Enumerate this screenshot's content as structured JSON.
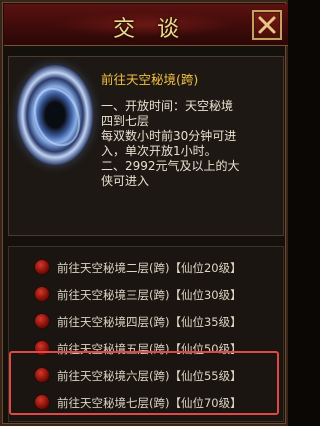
{
  "dialog": {
    "title": "交谈",
    "close_icon": "close-x-icon",
    "accent_color": "#f0d890",
    "highlight_color": "#e04848"
  },
  "info": {
    "title": "前往天空秘境(跨)",
    "image_icon": "vortex-portal-icon",
    "lines": [
      "一、开放时间：天空秘境",
      "四到七层",
      "每双数小时前30分钟可进",
      "入，单次开放1小时。",
      "二、2992元气及以上的大",
      "侠可进入"
    ]
  },
  "options": [
    {
      "label": "前往天空秘境二层(跨)【仙位20级】"
    },
    {
      "label": "前往天空秘境三层(跨)【仙位30级】"
    },
    {
      "label": "前往天空秘境四层(跨)【仙位35级】"
    },
    {
      "label": "前往天空秘境五层(跨)【仙位50级】"
    },
    {
      "label": "前往天空秘境六层(跨)【仙位55级】"
    },
    {
      "label": "前往天空秘境七层(跨)【仙位70级】"
    }
  ]
}
